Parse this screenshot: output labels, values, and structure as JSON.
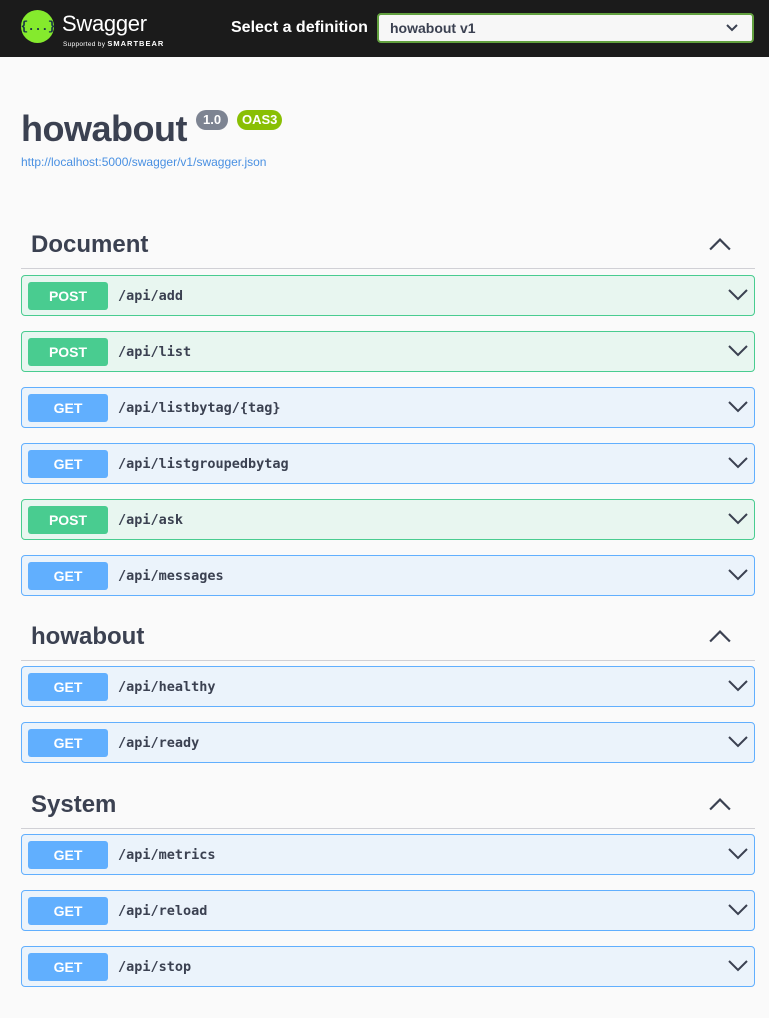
{
  "topbar": {
    "logo_glyph": "{...}",
    "brand": "Swagger",
    "brand_sub_prefix": "Supported by",
    "brand_sub_name": "SMARTBEAR",
    "select_label": "Select a definition",
    "select_value": "howabout v1"
  },
  "info": {
    "title": "howabout",
    "version": "1.0",
    "oas": "OAS3",
    "url": "http://localhost:5000/swagger/v1/swagger.json"
  },
  "sections": [
    {
      "title": "Document"
    },
    {
      "title": "howabout"
    },
    {
      "title": "System"
    }
  ],
  "ops": [
    {
      "method": "POST",
      "path": "/api/add"
    },
    {
      "method": "POST",
      "path": "/api/list"
    },
    {
      "method": "GET",
      "path": "/api/listbytag/{tag}"
    },
    {
      "method": "GET",
      "path": "/api/listgroupedbytag"
    },
    {
      "method": "POST",
      "path": "/api/ask"
    },
    {
      "method": "GET",
      "path": "/api/messages"
    },
    {
      "method": "GET",
      "path": "/api/healthy"
    },
    {
      "method": "GET",
      "path": "/api/ready"
    },
    {
      "method": "GET",
      "path": "/api/metrics"
    },
    {
      "method": "GET",
      "path": "/api/reload"
    },
    {
      "method": "GET",
      "path": "/api/stop"
    }
  ],
  "colors": {
    "post": "#49cc90",
    "get": "#61affe",
    "accent": "#85ea2d"
  },
  "icons": {
    "logo": "swagger-logo-icon",
    "select_chevron": "chevron-down-icon",
    "section_toggle": "chevron-up-icon",
    "op_toggle": "chevron-down-icon"
  }
}
